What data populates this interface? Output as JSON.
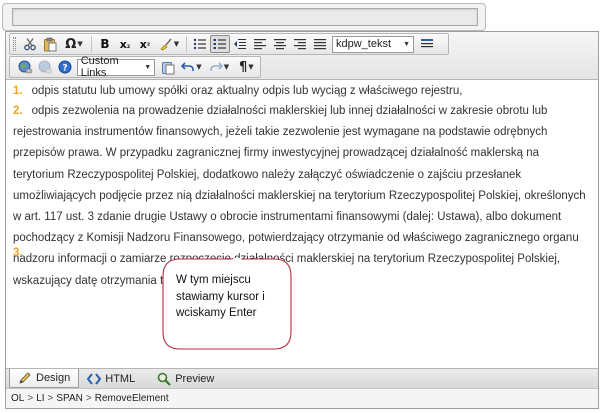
{
  "title_field": {
    "value": ""
  },
  "toolbar": {
    "row1": {
      "special_char_label": "Ω",
      "bold_label": "B",
      "subscript_label": "x",
      "subscript_small": "₂",
      "superscript_label": "x",
      "superscript_small": "²",
      "font_dropdown_value": "kdpw_tekst"
    },
    "row2": {
      "links_dropdown_value": "Custom Links",
      "paragraph_label": "¶"
    }
  },
  "content": {
    "items": [
      {
        "number": "1.",
        "text": "odpis statutu lub umowy spółki oraz aktualny odpis lub wyciąg z właściwego rejestru,"
      },
      {
        "number": "2.",
        "text": "odpis zezwolenia na prowadzenie działalności maklerskiej lub innej działalności w zakresie obrotu lub rejestrowania instrumentów finansowych, jeżeli takie zezwolenie jest wymagane na podstawie odrębnych przepisów prawa. W przypadku zagranicznej firmy inwestycyjnej prowadzącej działalność maklerską na terytorium Rzeczypospolitej Polskiej, dodatkowo należy załączyć oświadczenie o zajściu przesłanek umożliwiających podjęcie przez nią działalności maklerskiej na terytorium Rzeczypospolitej Polskiej, określonych w art. 117 ust. 3 zdanie drugie Ustawy o obrocie instrumentami finansowymi (dalej: Ustawa), albo dokument pochodzący z Komisji Nadzoru Finansowego, potwierdzający otrzymanie od właściwego zagranicznego organu nadzoru informacji o zamiarze rozpoczęcie działalności maklerskiej na terytorium Rzeczypospolitej Polskiej, wskazujący datę otrzymania tej informacji,"
      },
      {
        "number": "3.",
        "text": ""
      }
    ],
    "cursor_color": "#c00000",
    "number_color": "#f4a21f"
  },
  "callout": {
    "text": "W tym miejscu\nstawiamy kursor i\nwciskamy Enter"
  },
  "mode_tabs": [
    {
      "label": "Design",
      "icon": "pencil-icon",
      "selected": true
    },
    {
      "label": "HTML",
      "icon": "code-brackets-icon",
      "selected": false
    },
    {
      "label": "Preview",
      "icon": "magnifier-icon",
      "selected": false
    }
  ],
  "path_bar": {
    "items": [
      "OL",
      "LI",
      "SPAN",
      "RemoveElement"
    ],
    "separator": ">"
  }
}
